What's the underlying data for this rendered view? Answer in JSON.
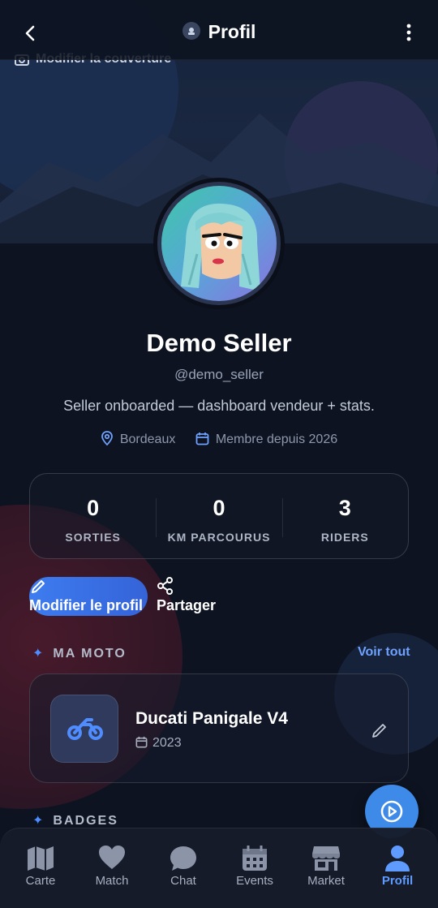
{
  "header": {
    "title": "Profil",
    "cover_edit_label": "Modifier la couverture"
  },
  "profile": {
    "name": "Demo Seller",
    "handle": "@demo_seller",
    "bio": "Seller onboarded — dashboard vendeur + stats.",
    "location": "Bordeaux",
    "member_since": "Membre depuis 2026"
  },
  "stats": [
    {
      "value": "0",
      "label": "SORTIES"
    },
    {
      "value": "0",
      "label": "KM PARCOURUS"
    },
    {
      "value": "3",
      "label": "RIDERS"
    }
  ],
  "actions": {
    "edit_profile": "Modifier le profil",
    "share": "Partager"
  },
  "moto_section": {
    "title": "MA MOTO",
    "see_all": "Voir tout"
  },
  "moto": {
    "name": "Ducati Panigale V4",
    "year": "2023"
  },
  "badges_section": {
    "title": "BADGES"
  },
  "nav": [
    {
      "label": "Carte",
      "icon": "map-icon"
    },
    {
      "label": "Match",
      "icon": "heart-icon"
    },
    {
      "label": "Chat",
      "icon": "chat-bubble-icon"
    },
    {
      "label": "Events",
      "icon": "calendar-icon"
    },
    {
      "label": "Market",
      "icon": "store-icon"
    },
    {
      "label": "Profil",
      "icon": "user-icon",
      "active": true
    }
  ],
  "colors": {
    "accent": "#3e8ae8",
    "active_nav": "#5f9bff",
    "background": "#0d1320"
  }
}
